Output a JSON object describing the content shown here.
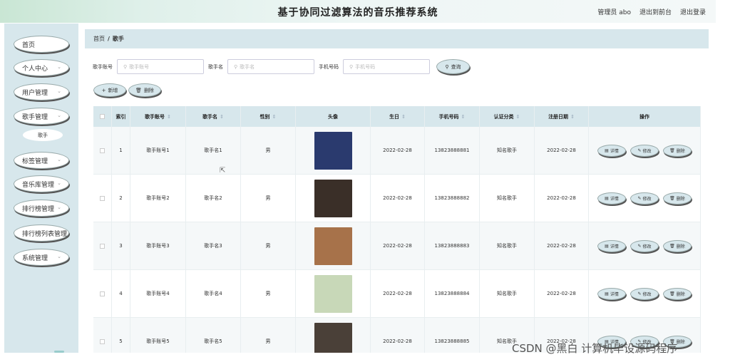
{
  "header": {
    "title": "基于协同过滤算法的音乐推荐系统",
    "admin_label": "管理员 abo",
    "front_link": "退出到前台",
    "logout_link": "退出登录"
  },
  "sidebar": {
    "items": [
      {
        "label": "首页",
        "has_arrow": false
      },
      {
        "label": "个人中心",
        "has_arrow": true
      },
      {
        "label": "用户管理",
        "has_arrow": true
      },
      {
        "label": "歌手管理",
        "has_arrow": true
      },
      {
        "label": "标签管理",
        "has_arrow": true
      },
      {
        "label": "音乐库管理",
        "has_arrow": true
      },
      {
        "label": "排行榜管理",
        "has_arrow": true
      },
      {
        "label": "排行榜列表管理",
        "has_arrow": false
      },
      {
        "label": "系统管理",
        "has_arrow": true
      }
    ],
    "sub_item": "歌手"
  },
  "breadcrumb": {
    "home": "首页",
    "sep": "/",
    "current": "歌手"
  },
  "search": {
    "fields": [
      {
        "label": "歌手账号",
        "placeholder": "歌手账号"
      },
      {
        "label": "歌手名",
        "placeholder": "歌手名"
      },
      {
        "label": "手机号码",
        "placeholder": "手机号码"
      }
    ],
    "query_label": "查询"
  },
  "toolbar": {
    "add_label": "新增",
    "delete_label": "删除"
  },
  "table": {
    "columns": [
      "索引",
      "歌手账号",
      "歌手名",
      "性别",
      "头像",
      "生日",
      "手机号码",
      "认证分类",
      "注册日期",
      "操作"
    ],
    "rows": [
      {
        "index": "1",
        "account": "歌手账号1",
        "name": "歌手名1",
        "gender": "男",
        "avatar_color": "#2a3a6e",
        "birthday": "2022-02-28",
        "phone": "13823888881",
        "category": "知名歌手",
        "reg_date": "2022-02-28"
      },
      {
        "index": "2",
        "account": "歌手账号2",
        "name": "歌手名2",
        "gender": "男",
        "avatar_color": "#3a2f28",
        "birthday": "2022-02-28",
        "phone": "13823888882",
        "category": "知名歌手",
        "reg_date": "2022-02-28"
      },
      {
        "index": "3",
        "account": "歌手账号3",
        "name": "歌手名3",
        "gender": "男",
        "avatar_color": "#a7724a",
        "birthday": "2022-02-28",
        "phone": "13823888883",
        "category": "知名歌手",
        "reg_date": "2022-02-28"
      },
      {
        "index": "4",
        "account": "歌手账号4",
        "name": "歌手名4",
        "gender": "男",
        "avatar_color": "#c8d8b8",
        "birthday": "2022-02-28",
        "phone": "13823888884",
        "category": "知名歌手",
        "reg_date": "2022-02-28"
      },
      {
        "index": "5",
        "account": "歌手账号5",
        "name": "歌手名5",
        "gender": "男",
        "avatar_color": "#4a4038",
        "birthday": "2022-02-28",
        "phone": "13823888885",
        "category": "知名歌手",
        "reg_date": "2022-02-28"
      }
    ],
    "ops": {
      "detail": "详情",
      "edit": "修改",
      "delete": "删除"
    }
  },
  "watermark": "CSDN @黑白   计算机毕设源码程序",
  "colors": {
    "panel": "#d7e7ec",
    "button_bg": "#d7e7ec",
    "header_bg": "#dff0ea"
  },
  "icons": {
    "search": "search-icon",
    "add": "plus-icon",
    "delete": "trash-icon",
    "detail": "doc-icon",
    "edit": "pencil-icon",
    "chevron": "chevron-down-icon"
  }
}
